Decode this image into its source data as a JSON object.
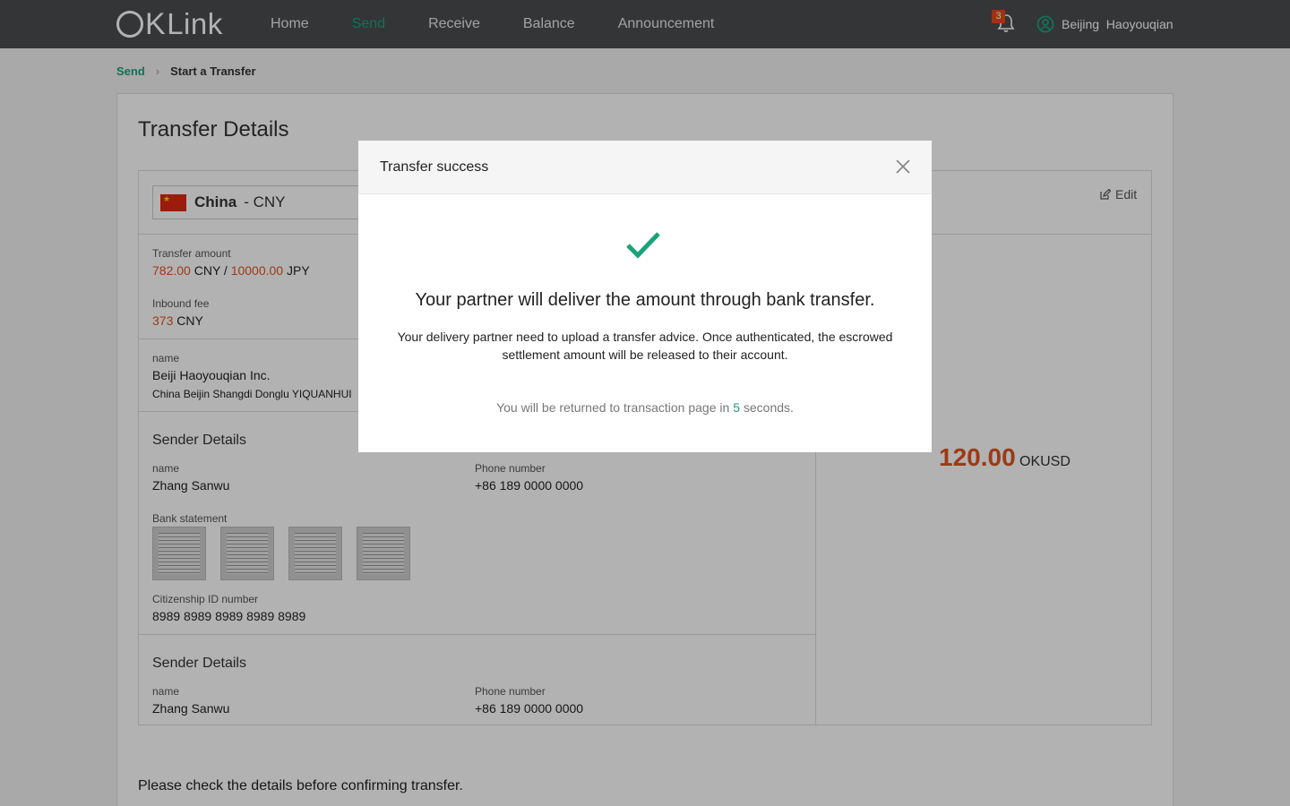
{
  "nav": {
    "logo": "OKLink",
    "items": [
      {
        "label": "Home"
      },
      {
        "label": "Send"
      },
      {
        "label": "Receive"
      },
      {
        "label": "Balance"
      },
      {
        "label": "Announcement"
      }
    ],
    "active": "Send",
    "notification_count": "3",
    "user_name": "Beijing  Haoyouqian"
  },
  "breadcrumb": {
    "parent": "Send",
    "current": "Start a Transfer"
  },
  "card": {
    "title": "Transfer Details",
    "country": "China",
    "currency": "- CNY",
    "transfer_amount_label": "Transfer amount",
    "transfer_amount_cny": "782.00",
    "cny": "CNY",
    "slash": "/",
    "transfer_amount_jpy": "10000.00",
    "jpy": "JPY",
    "inbound_fee_label": "Inbound fee",
    "inbound_fee": "373",
    "inbound_fee_cur": "CNY",
    "recipient_name_label": "name",
    "recipient_name": "Beiji Haoyouqian Inc.",
    "recipient_address": "China  Beijin  Shangdi Donglu YIQUANHUI",
    "edit": "Edit",
    "big_amount": "120.00",
    "big_unit": "OKUSD",
    "confirm_note": "Please check the details before confirming transfer."
  },
  "sender1": {
    "heading": "Sender Details",
    "name_label": "name",
    "name": "Zhang Sanwu",
    "phone_label": "Phone number",
    "phone": "+86 189 0000 0000",
    "bank_label": "Bank statement",
    "id_label": "Citizenship ID number",
    "id": "8989 8989 8989 8989 8989"
  },
  "sender2": {
    "heading": "Sender Details",
    "name_label": "name",
    "name": "Zhang Sanwu",
    "phone_label": "Phone number",
    "phone": "+86 189 0000 0000"
  },
  "modal": {
    "title": "Transfer success",
    "message": "Your partner will deliver the amount through bank transfer.",
    "description": "Your delivery partner need to upload a transfer advice. Once authenticated, the escrowed settlement amount will be released to their account.",
    "footer_before": "You will be returned to transaction page in ",
    "countdown": "5",
    "footer_after": " seconds."
  },
  "colors": {
    "accent": "#1aa37a",
    "amount": "#e0541f",
    "topbar": "#4a4d50"
  }
}
